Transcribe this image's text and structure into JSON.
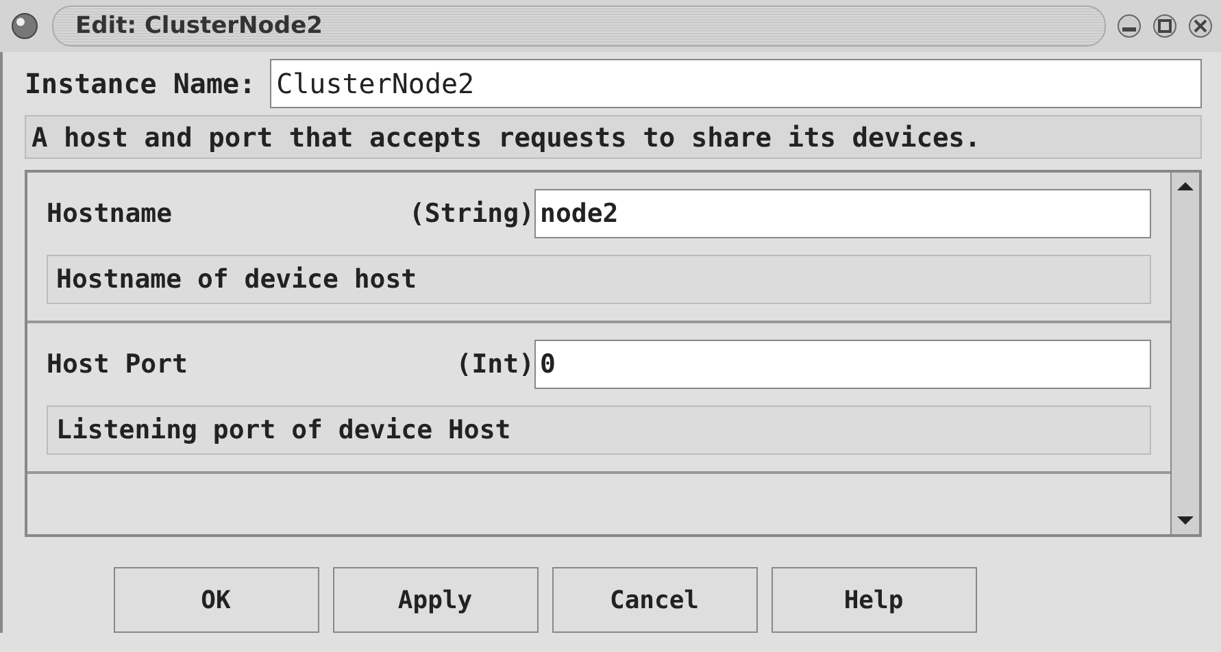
{
  "window": {
    "title": "Edit: ClusterNode2"
  },
  "instance": {
    "label": "Instance Name:",
    "value": "ClusterNode2"
  },
  "description": "A host and port that accepts requests to share its devices.",
  "properties": [
    {
      "name": "Hostname",
      "type": "(String)",
      "value": "node2",
      "help": "Hostname of device host"
    },
    {
      "name": "Host Port",
      "type": "(Int)",
      "value": "0",
      "help": "Listening port of device Host"
    }
  ],
  "buttons": [
    "OK",
    "Apply",
    "Cancel",
    "Help"
  ]
}
